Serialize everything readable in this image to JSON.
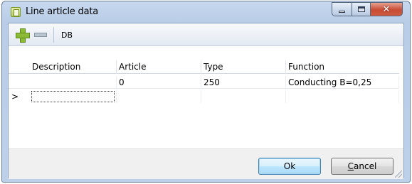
{
  "window": {
    "title": "Line article data",
    "icon": "table-icon",
    "controls": {
      "minimize": "minimize-icon",
      "maximize": "maximize-icon",
      "close": "close-icon"
    }
  },
  "toolbar": {
    "add_icon": "plus-icon",
    "remove_icon": "minus-icon",
    "db_label": "DB"
  },
  "grid": {
    "columns": [
      "Description",
      "Article",
      "Type",
      "Function"
    ],
    "rows": [
      {
        "description": "",
        "article": "0",
        "type": "250",
        "function": "Conducting B=0,25"
      }
    ],
    "new_row_indicator": ">"
  },
  "buttons": {
    "ok_label": "Ok",
    "cancel_label_prefix": "",
    "cancel_label_mnemonic": "C",
    "cancel_label_rest": "ancel"
  },
  "colors": {
    "titlebar": "#bcd0ea",
    "close_button": "#c74c34",
    "add_icon": "#8cb936",
    "ok_button_border": "#3c7fb1"
  }
}
